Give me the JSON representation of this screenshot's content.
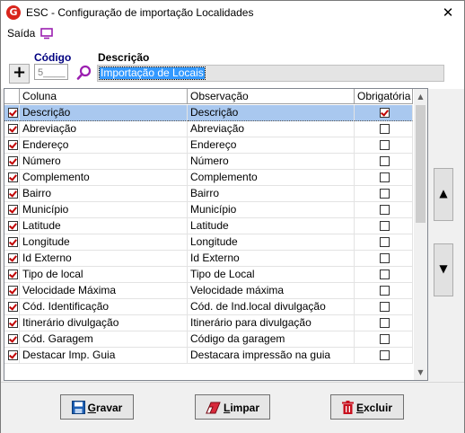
{
  "window": {
    "title": "ESC - Configuração de importação Localidades",
    "app_icon_letter": "G",
    "close_glyph": "✕"
  },
  "menu": {
    "saida_label": "Saída"
  },
  "form": {
    "add_glyph": "+",
    "codigo_label": "Código",
    "codigo_value": "5____",
    "descricao_label": "Descrição",
    "descricao_value": "Importação de Locais"
  },
  "grid": {
    "headers": {
      "coluna": "Coluna",
      "observacao": "Observação",
      "obrigatoria": "Obrigatória"
    },
    "rows": [
      {
        "checked": true,
        "coluna": "Descrição",
        "observacao": "Descrição",
        "obrigatoria": true,
        "selected": true
      },
      {
        "checked": true,
        "coluna": "Abreviação",
        "observacao": "Abreviação",
        "obrigatoria": false
      },
      {
        "checked": true,
        "coluna": "Endereço",
        "observacao": "Endereço",
        "obrigatoria": false
      },
      {
        "checked": true,
        "coluna": "Número",
        "observacao": "Número",
        "obrigatoria": false
      },
      {
        "checked": true,
        "coluna": "Complemento",
        "observacao": "Complemento",
        "obrigatoria": false
      },
      {
        "checked": true,
        "coluna": "Bairro",
        "observacao": "Bairro",
        "obrigatoria": false
      },
      {
        "checked": true,
        "coluna": "Município",
        "observacao": "Município",
        "obrigatoria": false
      },
      {
        "checked": true,
        "coluna": "Latitude",
        "observacao": "Latitude",
        "obrigatoria": false
      },
      {
        "checked": true,
        "coluna": "Longitude",
        "observacao": "Longitude",
        "obrigatoria": false
      },
      {
        "checked": true,
        "coluna": "Id Externo",
        "observacao": "Id Externo",
        "obrigatoria": false
      },
      {
        "checked": true,
        "coluna": "Tipo de local",
        "observacao": "Tipo de Local",
        "obrigatoria": false
      },
      {
        "checked": true,
        "coluna": "Velocidade Máxima",
        "observacao": "Velocidade máxima",
        "obrigatoria": false
      },
      {
        "checked": true,
        "coluna": "Cód. Identificação",
        "observacao": "Cód. de Ind.local divulgação",
        "obrigatoria": false
      },
      {
        "checked": true,
        "coluna": "Itinerário divulgação",
        "observacao": "Itinerário para divulgação",
        "obrigatoria": false
      },
      {
        "checked": true,
        "coluna": "Cód. Garagem",
        "observacao": "Código da garagem",
        "obrigatoria": false
      },
      {
        "checked": true,
        "coluna": "Destacar Imp. Guia",
        "observacao": "Destacara impressão na guia",
        "obrigatoria": false
      }
    ]
  },
  "side": {
    "up_glyph": "▲",
    "down_glyph": "▼"
  },
  "buttons": {
    "gravar": {
      "first": "G",
      "rest": "ravar"
    },
    "limpar": {
      "first": "L",
      "rest": "impar"
    },
    "excluir": {
      "first": "E",
      "rest": "xcluir"
    }
  },
  "colors": {
    "selection": "#a9c8ef",
    "highlight": "#3399ff",
    "check": "#c00000",
    "codigo_label": "#000080"
  }
}
